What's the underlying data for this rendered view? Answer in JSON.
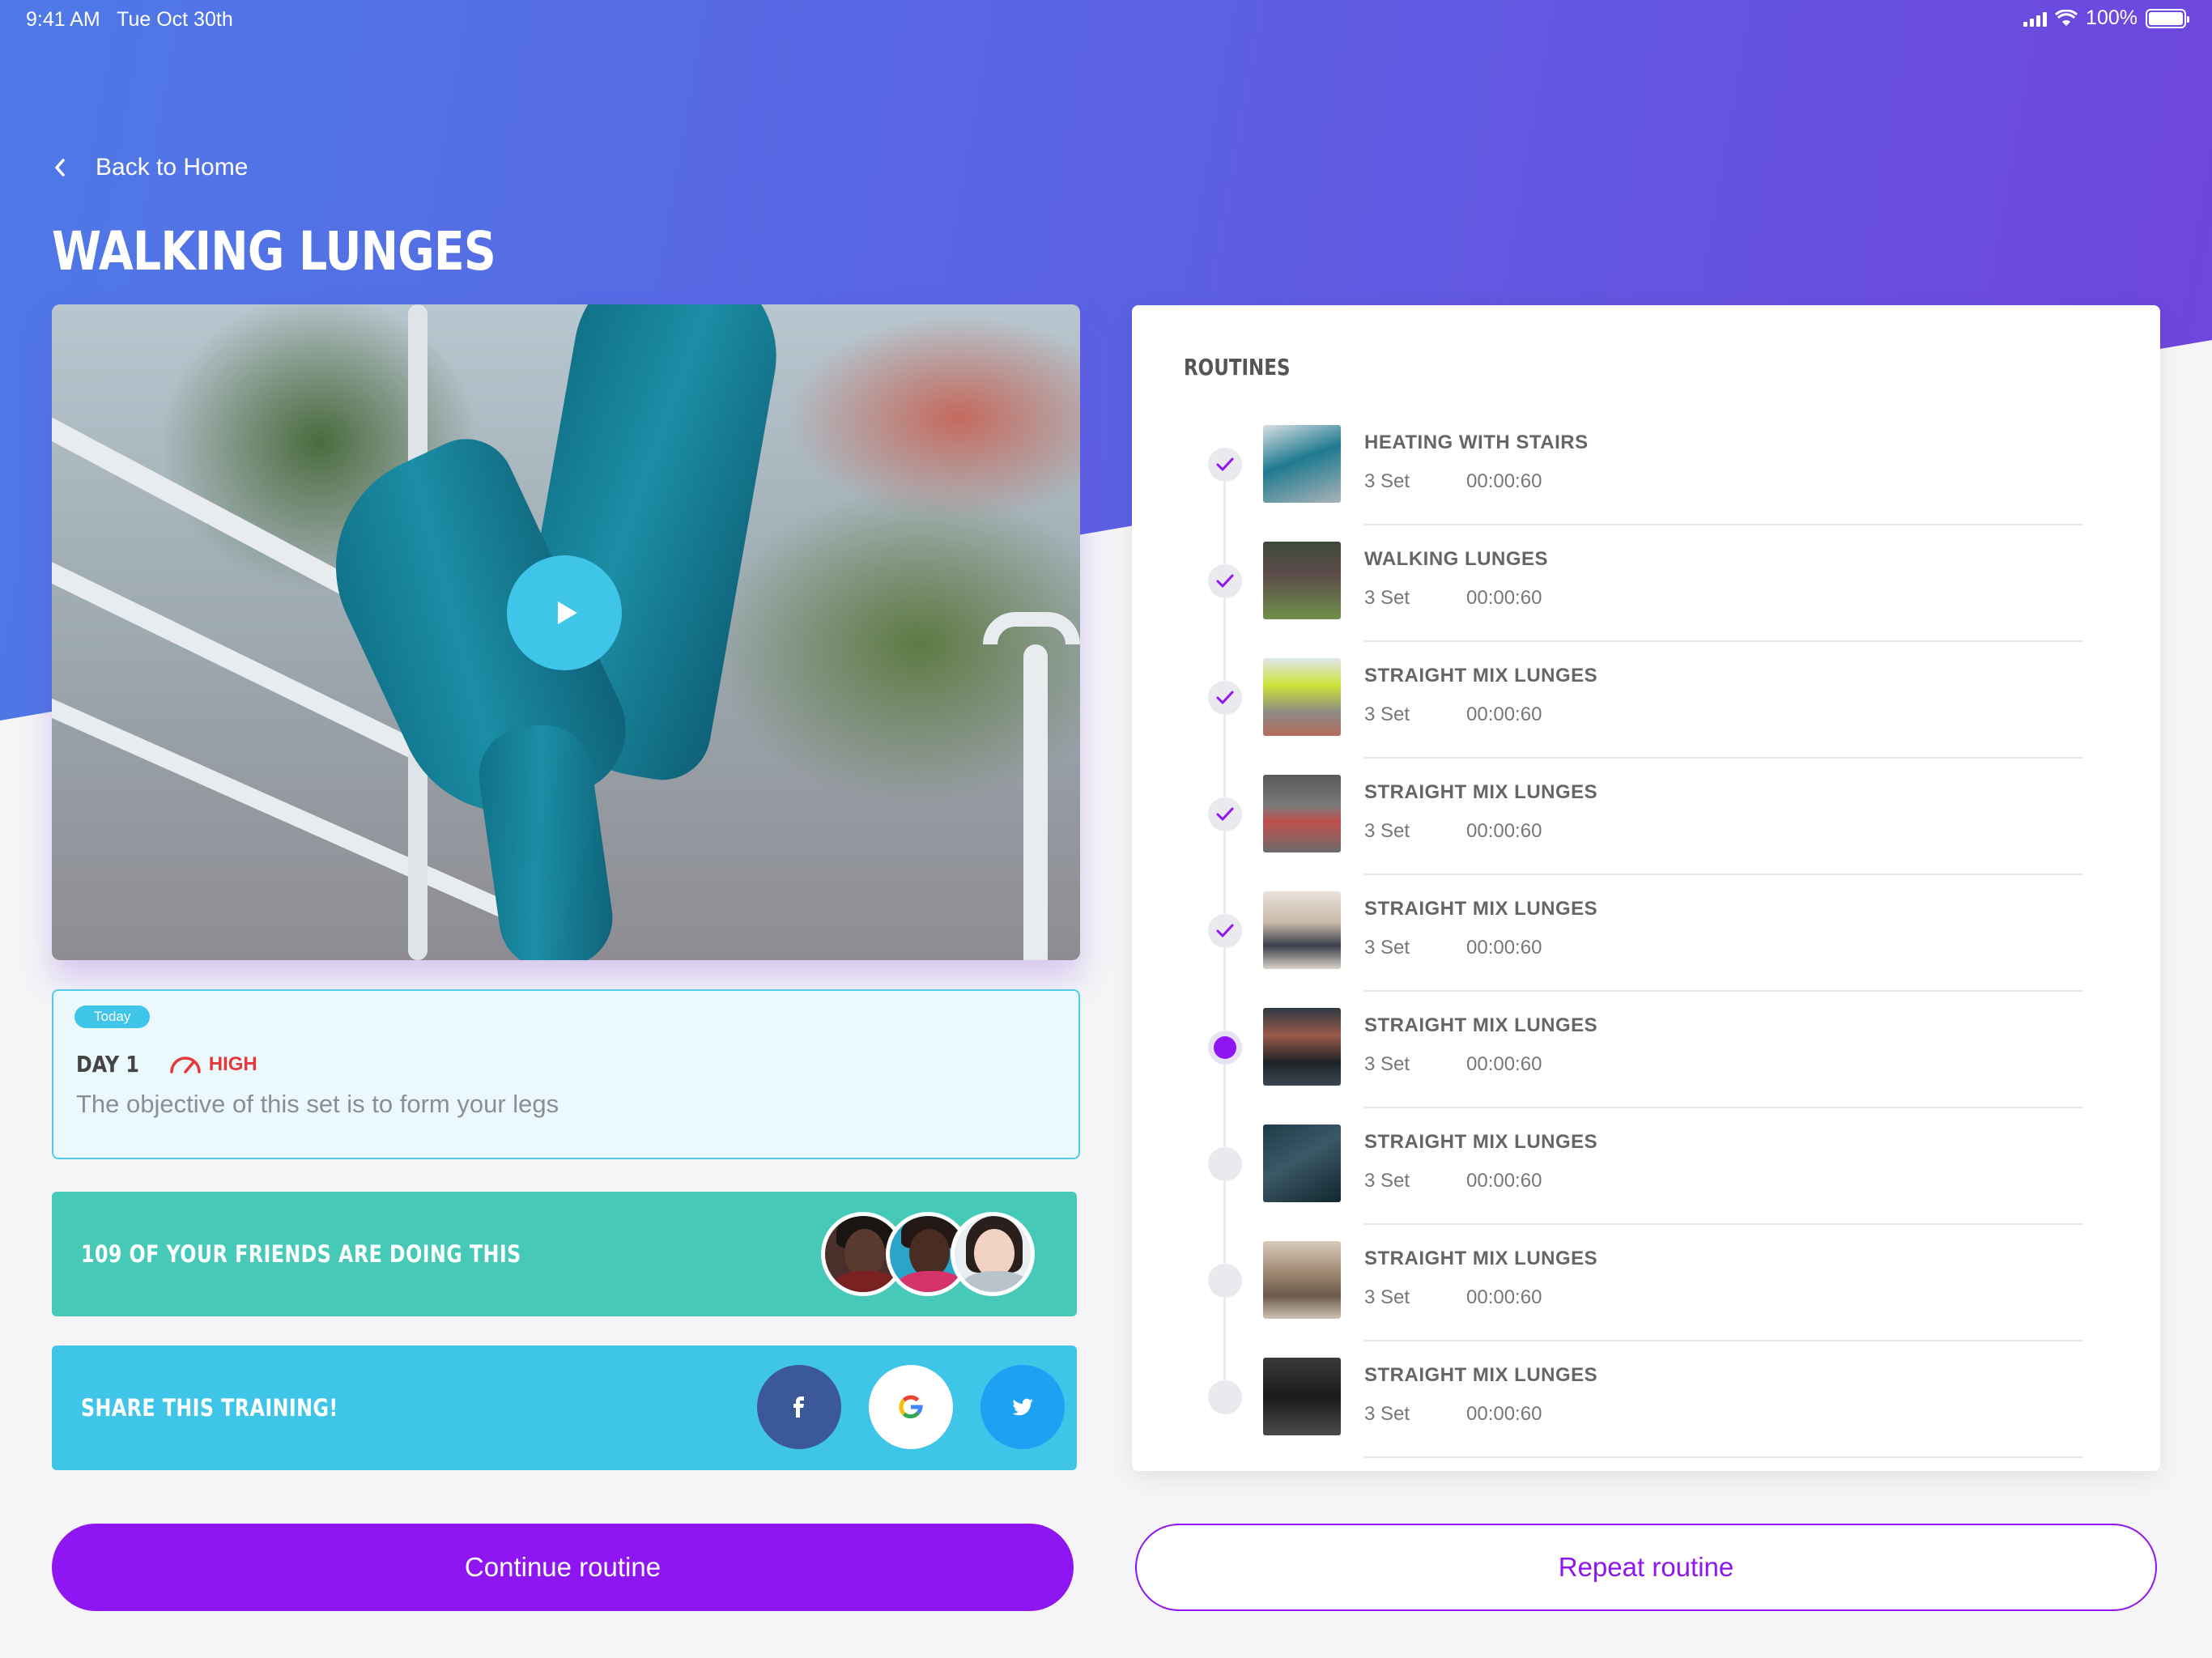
{
  "status_bar": {
    "time": "9:41 AM",
    "date": "Tue Oct 30th",
    "battery": "100%"
  },
  "nav": {
    "back_label": "Back to Home"
  },
  "page": {
    "title": "WALKING LUNGES"
  },
  "day_card": {
    "badge": "Today",
    "day": "DAY 1",
    "intensity": "HIGH",
    "description": "The objective of this set is to form your legs"
  },
  "friends": {
    "text": "109 OF YOUR FRIENDS ARE DOING THIS"
  },
  "share": {
    "text": "SHARE THIS TRAINING!"
  },
  "routines": {
    "title": "ROUTINES",
    "items": [
      {
        "name": "HEATING WITH STAIRS",
        "sets": "3 Set",
        "time": "00:00:60",
        "status": "done"
      },
      {
        "name": "WALKING  LUNGES",
        "sets": "3 Set",
        "time": "00:00:60",
        "status": "done"
      },
      {
        "name": "STRAIGHT MIX LUNGES",
        "sets": "3 Set",
        "time": "00:00:60",
        "status": "done"
      },
      {
        "name": "STRAIGHT MIX LUNGES",
        "sets": "3 Set",
        "time": "00:00:60",
        "status": "done"
      },
      {
        "name": "STRAIGHT MIX LUNGES",
        "sets": "3 Set",
        "time": "00:00:60",
        "status": "done"
      },
      {
        "name": "STRAIGHT MIX LUNGES",
        "sets": "3 Set",
        "time": "00:00:60",
        "status": "current"
      },
      {
        "name": "STRAIGHT MIX LUNGES",
        "sets": "3 Set",
        "time": "00:00:60",
        "status": "pending"
      },
      {
        "name": "STRAIGHT MIX LUNGES",
        "sets": "3 Set",
        "time": "00:00:60",
        "status": "pending"
      },
      {
        "name": "STRAIGHT MIX LUNGES",
        "sets": "3 Set",
        "time": "00:00:60",
        "status": "pending"
      }
    ]
  },
  "actions": {
    "continue_label": "Continue routine",
    "repeat_label": "Repeat routine"
  },
  "colors": {
    "accent": "#8f15f2",
    "header_gradient_start": "#4f79e6",
    "header_gradient_end": "#7340dd",
    "friends_band": "#46c9b7",
    "share_band": "#3ec5e8",
    "intensity_high": "#e5383b",
    "facebook": "#3b5998",
    "twitter": "#1da1f2"
  },
  "icons": {
    "back": "chevron-left-icon",
    "play": "play-icon",
    "intensity": "speedometer-icon",
    "done": "check-icon",
    "facebook": "facebook-icon",
    "google": "google-icon",
    "twitter": "twitter-icon"
  }
}
